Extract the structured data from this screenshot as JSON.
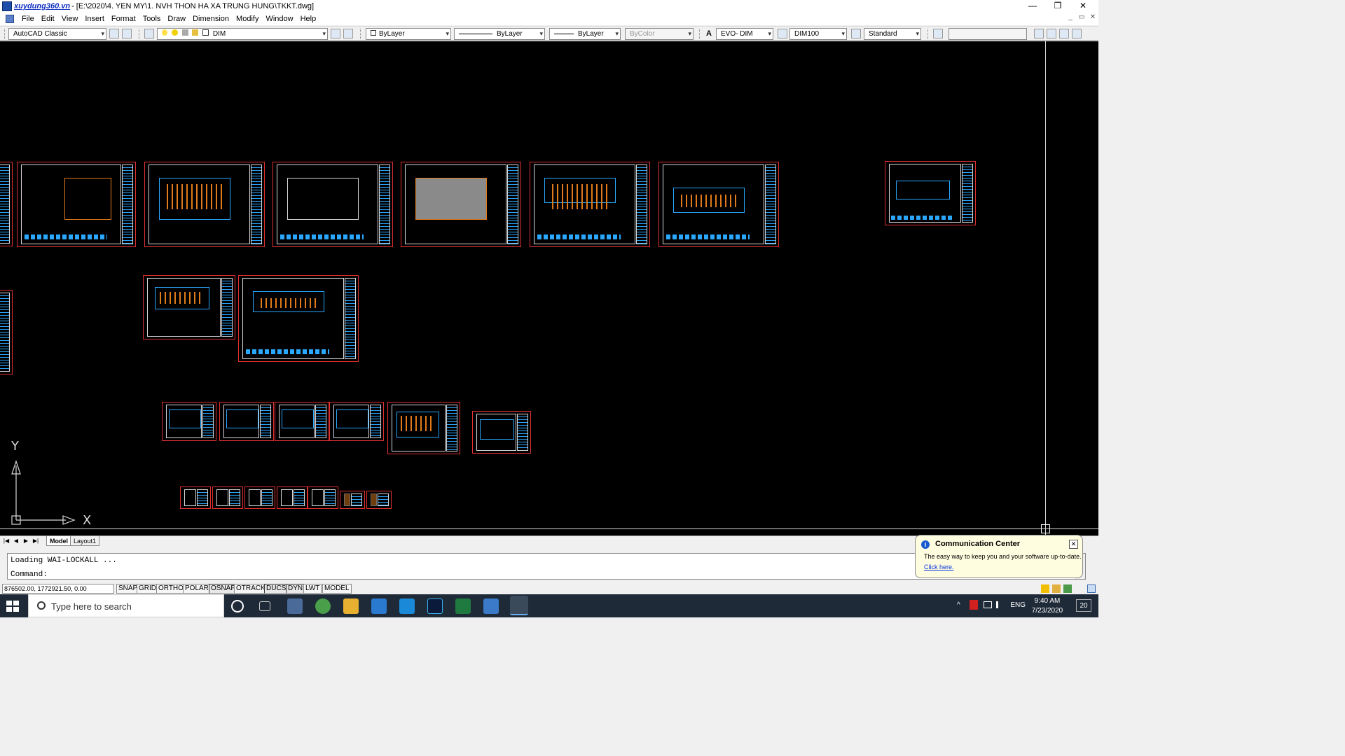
{
  "titlebar": {
    "brand": "xuydung360.vn",
    "title": "- [E:\\2020\\4. YEN MY\\1. NVH  THON HA XA TRUNG HUNG\\TKKT.dwg]",
    "minimize": "—",
    "restore": "❐",
    "close": "✕"
  },
  "menu": {
    "items": [
      "File",
      "Edit",
      "View",
      "Insert",
      "Format",
      "Tools",
      "Draw",
      "Dimension",
      "Modify",
      "Window",
      "Help"
    ],
    "doc_min": "_",
    "doc_restore": "▭",
    "doc_close": "✕"
  },
  "toolbar": {
    "workspace": "AutoCAD Classic",
    "layer": "DIM",
    "color": "ByLayer",
    "linetype": "ByLayer",
    "lineweight": "ByLayer",
    "plotstyle": "ByColor",
    "text_style": "EVO- DIM",
    "dim_style": "DIM100",
    "table_style": "Standard",
    "arrow": "▾"
  },
  "canvas": {
    "ucs_y": "Y",
    "ucs_x": "X"
  },
  "tabs": {
    "nav": [
      "|◀",
      "◀",
      "▶",
      "▶|"
    ],
    "items": [
      "Model",
      "Layout1"
    ]
  },
  "command": {
    "line1": "Loading WAI-LOCKALL ...",
    "line2": "Command:"
  },
  "status": {
    "coords": "876502.00, 1772921.50, 0.00",
    "toggles": [
      "SNAP",
      "GRID",
      "ORTHO",
      "POLAR",
      "OSNAP",
      "OTRACK",
      "DUCS",
      "DYN",
      "LWT",
      "MODEL"
    ]
  },
  "comm": {
    "title": "Communication Center",
    "body": "The easy way to keep you and your software up-to-date.",
    "link": "Click here.",
    "close": "✕",
    "info": "i"
  },
  "taskbar": {
    "search_placeholder": "Type here to search",
    "lang": "ENG",
    "time": "9:40 AM",
    "date": "7/23/2020",
    "notifications": "20"
  },
  "colors": {
    "accent": "#1e4ea8",
    "canvas": "#000000",
    "sheet_border": "#e03030",
    "drawing_blue": "#2aa8ff",
    "drawing_orange": "#e07a1a",
    "taskbar": "#1e2a38"
  }
}
